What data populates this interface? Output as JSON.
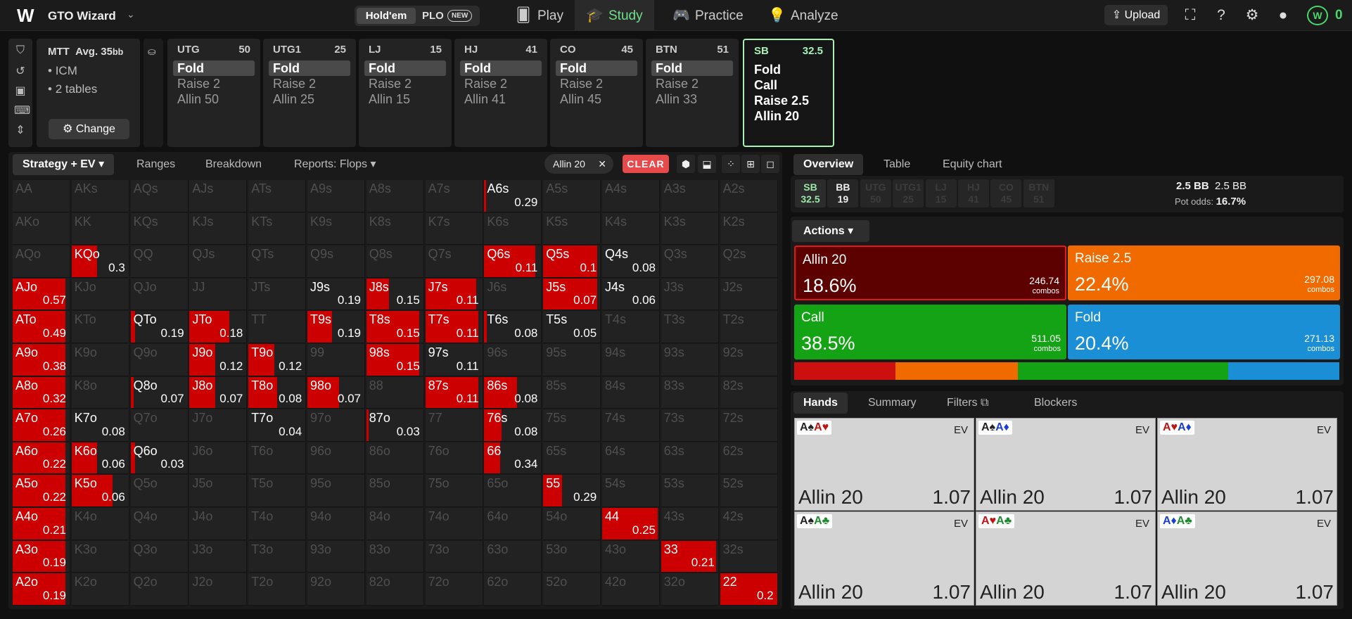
{
  "topbar": {
    "brand": "GTO Wizard",
    "game_holdem": "Hold'em",
    "game_plo": "PLO",
    "new_badge": "NEW",
    "nav": [
      {
        "label": "Play",
        "icon": "cards-icon"
      },
      {
        "label": "Study",
        "icon": "graduation-cap-icon"
      },
      {
        "label": "Practice",
        "icon": "gamepad-icon"
      },
      {
        "label": "Analyze",
        "icon": "lightbulb-icon"
      }
    ],
    "upload": "Upload",
    "coins": "0"
  },
  "config": {
    "mtt_title": "MTT",
    "avg_label": "Avg. 35",
    "avg_unit": "bb",
    "bullets": [
      "ICM",
      "2 tables"
    ],
    "change": "Change",
    "positions": [
      {
        "name": "UTG",
        "stack": "50",
        "actions": [
          "Fold",
          "Raise 2",
          "Allin 50"
        ],
        "selected": 0
      },
      {
        "name": "UTG1",
        "stack": "25",
        "actions": [
          "Fold",
          "Raise 2",
          "Allin 25"
        ],
        "selected": 0
      },
      {
        "name": "LJ",
        "stack": "15",
        "actions": [
          "Fold",
          "Raise 2",
          "Allin 15"
        ],
        "selected": 0
      },
      {
        "name": "HJ",
        "stack": "41",
        "actions": [
          "Fold",
          "Raise 2",
          "Allin 41"
        ],
        "selected": 0
      },
      {
        "name": "CO",
        "stack": "45",
        "actions": [
          "Fold",
          "Raise 2",
          "Allin 45"
        ],
        "selected": 0
      },
      {
        "name": "BTN",
        "stack": "51",
        "actions": [
          "Fold",
          "Raise 2",
          "Allin 33"
        ],
        "selected": 0
      },
      {
        "name": "SB",
        "stack": "32.5",
        "actions": [
          "Fold",
          "Call",
          "Raise 2.5",
          "Allin 20"
        ],
        "selected": -1
      }
    ]
  },
  "strategy": {
    "tabs": [
      "Strategy + EV",
      "Ranges",
      "Breakdown",
      "Reports: Flops"
    ],
    "filter_chip": "Allin 20",
    "clear": "CLEAR"
  },
  "matrix": {
    "rows": [
      [
        "AA",
        "AKs",
        "AQs",
        "AJs",
        "ATs",
        "A9s",
        "A8s",
        "A7s",
        "A6s",
        "A5s",
        "A4s",
        "A3s",
        "A2s"
      ],
      [
        "AKo",
        "KK",
        "KQs",
        "KJs",
        "KTs",
        "K9s",
        "K8s",
        "K7s",
        "K6s",
        "K5s",
        "K4s",
        "K3s",
        "K2s"
      ],
      [
        "AQo",
        "KQo",
        "QQ",
        "QJs",
        "QTs",
        "Q9s",
        "Q8s",
        "Q7s",
        "Q6s",
        "Q5s",
        "Q4s",
        "Q3s",
        "Q2s"
      ],
      [
        "AJo",
        "KJo",
        "QJo",
        "JJ",
        "JTs",
        "J9s",
        "J8s",
        "J7s",
        "J6s",
        "J5s",
        "J4s",
        "J3s",
        "J2s"
      ],
      [
        "ATo",
        "KTo",
        "QTo",
        "JTo",
        "TT",
        "T9s",
        "T8s",
        "T7s",
        "T6s",
        "T5s",
        "T4s",
        "T3s",
        "T2s"
      ],
      [
        "A9o",
        "K9o",
        "Q9o",
        "J9o",
        "T9o",
        "99",
        "98s",
        "97s",
        "96s",
        "95s",
        "94s",
        "93s",
        "92s"
      ],
      [
        "A8o",
        "K8o",
        "Q8o",
        "J8o",
        "T8o",
        "98o",
        "88",
        "87s",
        "86s",
        "85s",
        "84s",
        "83s",
        "82s"
      ],
      [
        "A7o",
        "K7o",
        "Q7o",
        "J7o",
        "T7o",
        "97o",
        "87o",
        "77",
        "76s",
        "75s",
        "74s",
        "73s",
        "72s"
      ],
      [
        "A6o",
        "K6o",
        "Q6o",
        "J6o",
        "T6o",
        "96o",
        "86o",
        "76o",
        "66",
        "65s",
        "64s",
        "63s",
        "62s"
      ],
      [
        "A5o",
        "K5o",
        "Q5o",
        "J5o",
        "T5o",
        "95o",
        "85o",
        "75o",
        "65o",
        "55",
        "54s",
        "53s",
        "52s"
      ],
      [
        "A4o",
        "K4o",
        "Q4o",
        "J4o",
        "T4o",
        "94o",
        "84o",
        "74o",
        "64o",
        "54o",
        "44",
        "43s",
        "42s"
      ],
      [
        "A3o",
        "K3o",
        "Q3o",
        "J3o",
        "T3o",
        "93o",
        "83o",
        "73o",
        "63o",
        "53o",
        "43o",
        "33",
        "32s"
      ],
      [
        "A2o",
        "K2o",
        "Q2o",
        "J2o",
        "T2o",
        "92o",
        "82o",
        "72o",
        "62o",
        "52o",
        "42o",
        "32o",
        "22"
      ]
    ],
    "highlights": [
      {
        "r": 0,
        "c": 8,
        "freq": 0.03,
        "ev": "0.29"
      },
      {
        "r": 2,
        "c": 1,
        "freq": 0.45,
        "ev": "0.3"
      },
      {
        "r": 2,
        "c": 8,
        "freq": 0.9,
        "ev": "0.11"
      },
      {
        "r": 2,
        "c": 9,
        "freq": 0.95,
        "ev": "0.1"
      },
      {
        "r": 2,
        "c": 10,
        "freq": 0,
        "ev": "0.08"
      },
      {
        "r": 3,
        "c": 0,
        "freq": 0.93,
        "ev": "0.57"
      },
      {
        "r": 3,
        "c": 5,
        "freq": 0,
        "ev": "0.19"
      },
      {
        "r": 3,
        "c": 6,
        "freq": 0.4,
        "ev": "0.15"
      },
      {
        "r": 3,
        "c": 7,
        "freq": 0.9,
        "ev": "0.11"
      },
      {
        "r": 3,
        "c": 9,
        "freq": 0.95,
        "ev": "0.07"
      },
      {
        "r": 3,
        "c": 10,
        "freq": 0,
        "ev": "0.06"
      },
      {
        "r": 4,
        "c": 0,
        "freq": 0.93,
        "ev": "0.49"
      },
      {
        "r": 4,
        "c": 2,
        "freq": 0.08,
        "ev": "0.19"
      },
      {
        "r": 4,
        "c": 3,
        "freq": 0.7,
        "ev": "0.18"
      },
      {
        "r": 4,
        "c": 5,
        "freq": 0.43,
        "ev": "0.19"
      },
      {
        "r": 4,
        "c": 6,
        "freq": 0.93,
        "ev": "0.15"
      },
      {
        "r": 4,
        "c": 7,
        "freq": 0.93,
        "ev": "0.11"
      },
      {
        "r": 4,
        "c": 8,
        "freq": 0.05,
        "ev": "0.08"
      },
      {
        "r": 4,
        "c": 9,
        "freq": 0,
        "ev": "0.05"
      },
      {
        "r": 5,
        "c": 0,
        "freq": 0.93,
        "ev": "0.38"
      },
      {
        "r": 5,
        "c": 3,
        "freq": 0.45,
        "ev": "0.12"
      },
      {
        "r": 5,
        "c": 4,
        "freq": 0.45,
        "ev": "0.12"
      },
      {
        "r": 5,
        "c": 6,
        "freq": 0.93,
        "ev": "0.15"
      },
      {
        "r": 5,
        "c": 7,
        "freq": 0,
        "ev": "0.11"
      },
      {
        "r": 6,
        "c": 0,
        "freq": 0.93,
        "ev": "0.32"
      },
      {
        "r": 6,
        "c": 2,
        "freq": 0.05,
        "ev": "0.07"
      },
      {
        "r": 6,
        "c": 3,
        "freq": 0.45,
        "ev": "0.07"
      },
      {
        "r": 6,
        "c": 4,
        "freq": 0.5,
        "ev": "0.08"
      },
      {
        "r": 6,
        "c": 5,
        "freq": 0.55,
        "ev": "0.07"
      },
      {
        "r": 6,
        "c": 7,
        "freq": 0.93,
        "ev": "0.11"
      },
      {
        "r": 6,
        "c": 8,
        "freq": 0.58,
        "ev": "0.08"
      },
      {
        "r": 7,
        "c": 0,
        "freq": 0.93,
        "ev": "0.26"
      },
      {
        "r": 7,
        "c": 1,
        "freq": 0,
        "ev": "0.08"
      },
      {
        "r": 7,
        "c": 4,
        "freq": 0,
        "ev": "0.04"
      },
      {
        "r": 7,
        "c": 6,
        "freq": 0.03,
        "ev": "0.03"
      },
      {
        "r": 7,
        "c": 8,
        "freq": 0.3,
        "ev": "0.08"
      },
      {
        "r": 8,
        "c": 0,
        "freq": 0.93,
        "ev": "0.22"
      },
      {
        "r": 8,
        "c": 1,
        "freq": 0.45,
        "ev": "0.06"
      },
      {
        "r": 8,
        "c": 2,
        "freq": 0.08,
        "ev": "0.03"
      },
      {
        "r": 8,
        "c": 8,
        "freq": 0.28,
        "ev": "0.34"
      },
      {
        "r": 9,
        "c": 0,
        "freq": 0.93,
        "ev": "0.22"
      },
      {
        "r": 9,
        "c": 1,
        "freq": 0.72,
        "ev": "0.06"
      },
      {
        "r": 9,
        "c": 9,
        "freq": 0.33,
        "ev": "0.29"
      },
      {
        "r": 10,
        "c": 0,
        "freq": 0.93,
        "ev": "0.21"
      },
      {
        "r": 10,
        "c": 10,
        "freq": 0.97,
        "ev": "0.25"
      },
      {
        "r": 11,
        "c": 0,
        "freq": 0.93,
        "ev": "0.19"
      },
      {
        "r": 11,
        "c": 11,
        "freq": 0.97,
        "ev": "0.21"
      },
      {
        "r": 12,
        "c": 0,
        "freq": 0.93,
        "ev": "0.19"
      },
      {
        "r": 12,
        "c": 12,
        "freq": 1,
        "ev": "0.2"
      }
    ]
  },
  "overview": {
    "tabs": [
      "Overview",
      "Table",
      "Equity chart"
    ],
    "seats": [
      {
        "n": "SB",
        "s": "32.5"
      },
      {
        "n": "BB",
        "s": "19"
      },
      {
        "n": "UTG",
        "s": "50"
      },
      {
        "n": "UTG1",
        "s": "25"
      },
      {
        "n": "LJ",
        "s": "15"
      },
      {
        "n": "HJ",
        "s": "41"
      },
      {
        "n": "CO",
        "s": "45"
      },
      {
        "n": "BTN",
        "s": "51"
      }
    ],
    "pot_bb": "2.5 BB",
    "pot_bb2": "2.5 BB",
    "pot_odds_label": "Pot odds:",
    "pot_odds": "16.7%",
    "actions_label": "Actions",
    "actions": [
      {
        "name": "Allin 20",
        "pct": "18.6%",
        "combos": "246.74",
        "combos_label": "combos",
        "color": "#5c0000",
        "frac": 0.186
      },
      {
        "name": "Raise 2.5",
        "pct": "22.4%",
        "combos": "297.08",
        "combos_label": "combos",
        "color": "#f06a00",
        "frac": 0.224
      },
      {
        "name": "Call",
        "pct": "38.5%",
        "combos": "511.05",
        "combos_label": "combos",
        "color": "#14a314",
        "frac": 0.385
      },
      {
        "name": "Fold",
        "pct": "20.4%",
        "combos": "271.13",
        "combos_label": "combos",
        "color": "#1a8fd6",
        "frac": 0.204
      }
    ],
    "strip_colors": [
      "#cc0f0f",
      "#f06a00",
      "#14a314",
      "#1a8fd6"
    ]
  },
  "hands": {
    "tabs": [
      "Hands",
      "Summary",
      "Filters",
      "Blockers"
    ],
    "cards": [
      {
        "c1": "A♠",
        "c1c": "blk",
        "c2": "A♥",
        "c2c": "red",
        "ev_label": "EV",
        "action": "Allin 20",
        "ev": "1.07"
      },
      {
        "c1": "A♠",
        "c1c": "blk",
        "c2": "A♦",
        "c2c": "blu",
        "ev_label": "EV",
        "action": "Allin 20",
        "ev": "1.07"
      },
      {
        "c1": "A♥",
        "c1c": "red",
        "c2": "A♦",
        "c2c": "blu",
        "ev_label": "EV",
        "action": "Allin 20",
        "ev": "1.07"
      },
      {
        "c1": "A♠",
        "c1c": "blk",
        "c2": "A♣",
        "c2c": "grn",
        "ev_label": "EV",
        "action": "Allin 20",
        "ev": "1.07"
      },
      {
        "c1": "A♥",
        "c1c": "red",
        "c2": "A♣",
        "c2c": "grn",
        "ev_label": "EV",
        "action": "Allin 20",
        "ev": "1.07"
      },
      {
        "c1": "A♦",
        "c1c": "blu",
        "c2": "A♣",
        "c2c": "grn",
        "ev_label": "EV",
        "action": "Allin 20",
        "ev": "1.07"
      }
    ]
  }
}
